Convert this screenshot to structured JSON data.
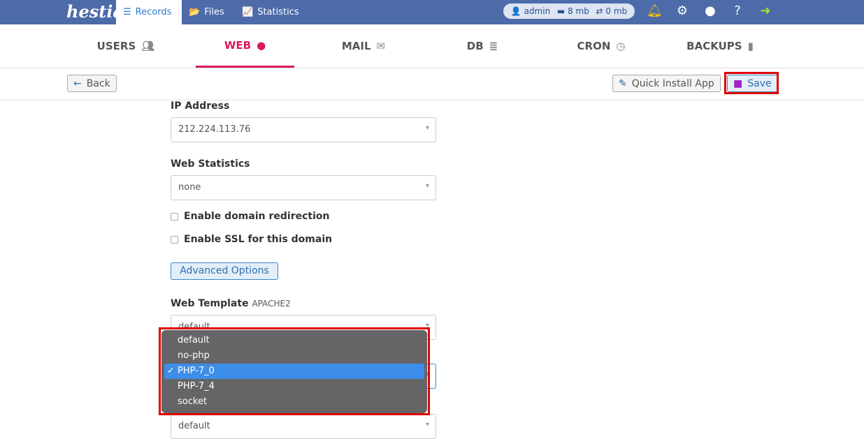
{
  "topbar": {
    "logo": "hestia",
    "nav": [
      {
        "label": "Records",
        "icon": "list-check-icon",
        "active": true
      },
      {
        "label": "Files",
        "icon": "folder-open-icon"
      },
      {
        "label": "Statistics",
        "icon": "chart-line-icon"
      }
    ],
    "user": "admin",
    "disk": "8 mb",
    "bandwidth": "0 mb",
    "bell_color": "#ffc107",
    "logout_color": "#a6e22e"
  },
  "tabs": [
    {
      "label": "USERS",
      "icon": "users-icon"
    },
    {
      "label": "WEB",
      "icon": "globe-icon",
      "active": true
    },
    {
      "label": "MAIL",
      "icon": "mail-bulk-icon"
    },
    {
      "label": "DB",
      "icon": "database-icon"
    },
    {
      "label": "CRON",
      "icon": "clock-icon"
    },
    {
      "label": "BACKUPS",
      "icon": "file-archive-icon"
    }
  ],
  "toolbar": {
    "back": "Back",
    "quick_install": "Quick Install App",
    "save": "Save"
  },
  "form": {
    "ip_label": "IP Address",
    "ip_value": "212.224.113.76",
    "stats_label": "Web Statistics",
    "stats_value": "none",
    "redirect_label": "Enable domain redirection",
    "ssl_label": "Enable SSL for this domain",
    "advanced": "Advanced Options",
    "template_label": "Web Template",
    "template_sub": "APACHE2",
    "template_value": "default",
    "next_value": "default"
  },
  "dropdown": {
    "options": [
      "default",
      "no-php",
      "PHP-7_0",
      "PHP-7_4",
      "socket"
    ],
    "selected": "PHP-7_0"
  },
  "accent": "#d91a5e",
  "brand": "#4c6ba8"
}
